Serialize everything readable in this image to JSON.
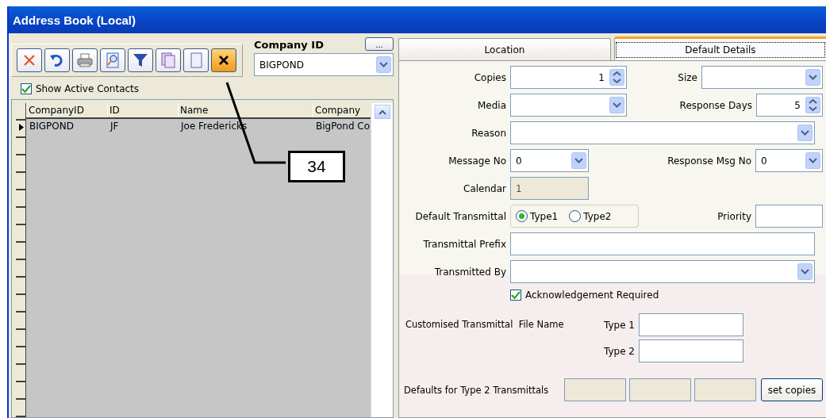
{
  "window": {
    "title": "Address Book (Local)"
  },
  "toolbar": {
    "buttons": [
      {
        "kind": "delete"
      },
      {
        "kind": "undo"
      },
      {
        "kind": "print"
      },
      {
        "kind": "preview"
      },
      {
        "kind": "filter"
      },
      {
        "kind": "copy"
      },
      {
        "kind": "new"
      },
      {
        "kind": "close"
      }
    ]
  },
  "company_id": {
    "label": "Company ID",
    "value": "BIGPOND",
    "more_button": "..."
  },
  "show_active_contacts": {
    "label": "Show Active Contacts",
    "checked": true
  },
  "grid": {
    "columns": [
      "CompanyID",
      "ID",
      "Name",
      "Company"
    ],
    "rows": [
      {
        "current": true,
        "cells": [
          "BIGPOND",
          "JF",
          "Joe Fredericks",
          "BigPond Co"
        ]
      }
    ]
  },
  "tabs": [
    {
      "label": "Location",
      "selected": false
    },
    {
      "label": "Default Details",
      "selected": true
    }
  ],
  "form": {
    "copies": {
      "label": "Copies",
      "value": "1"
    },
    "size": {
      "label": "Size"
    },
    "media": {
      "label": "Media"
    },
    "response_days": {
      "label": "Response Days",
      "value": "5"
    },
    "reason": {
      "label": "Reason"
    },
    "message_no": {
      "label": "Message No",
      "value": "0"
    },
    "response_msg_no": {
      "label": "Response Msg No",
      "value": "0"
    },
    "calendar": {
      "label": "Calendar",
      "value": "1",
      "disabled": true
    },
    "default_transmittal": {
      "label": "Default Transmittal",
      "options": [
        {
          "label": "Type1",
          "selected": true
        },
        {
          "label": "Type2",
          "selected": false
        }
      ]
    },
    "priority": {
      "label": "Priority"
    },
    "transmittal_prefix": {
      "label": "Transmittal Prefix"
    },
    "transmitted_by": {
      "label": "Transmitted By"
    },
    "acknowledgement_required": {
      "label": "Acknowledgement Required",
      "checked": true
    },
    "customised_file_name": {
      "label": "Customised Transmittal  File Name",
      "types": [
        {
          "label": "Type 1"
        },
        {
          "label": "Type 2"
        }
      ]
    },
    "type2_defaults": {
      "label": "Defaults for Type 2 Transmittals",
      "boxes": [
        {
          "disabled": true
        },
        {
          "disabled": true
        },
        {
          "disabled": true
        }
      ],
      "button": "set copies"
    }
  },
  "callout": {
    "label": "34"
  }
}
